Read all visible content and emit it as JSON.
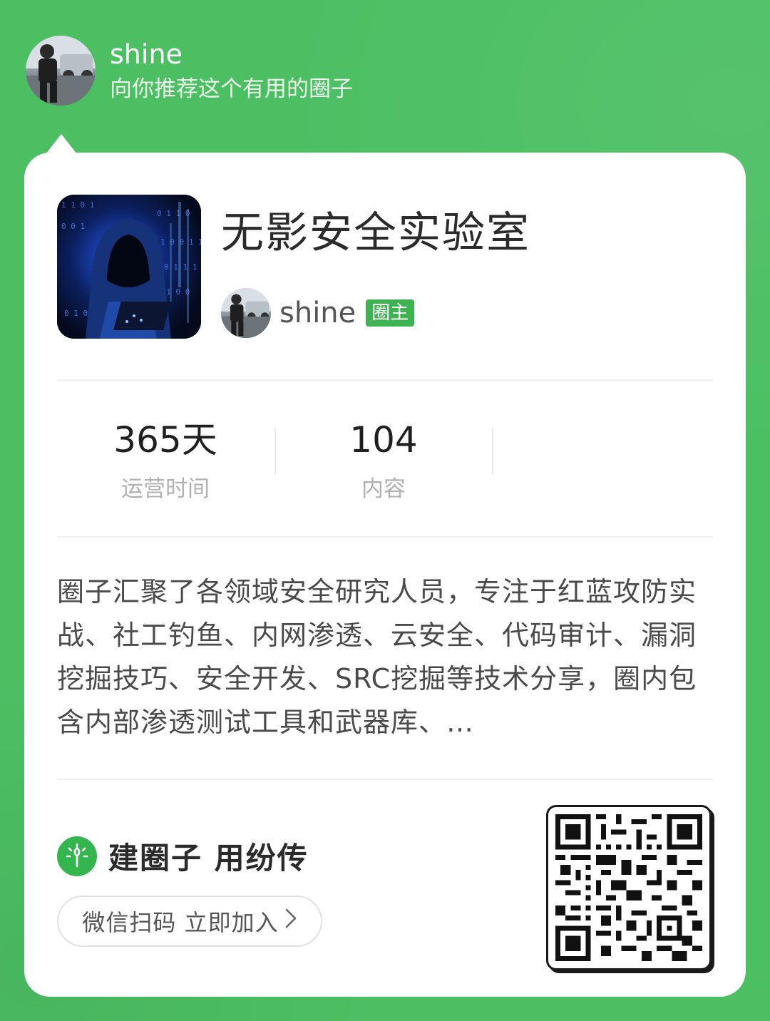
{
  "sharer": {
    "name": "shine",
    "message": "向你推荐这个有用的圈子"
  },
  "group": {
    "title": "无影安全实验室",
    "owner_name": "shine",
    "owner_badge": "圈主"
  },
  "stats": [
    {
      "value": "365天",
      "label": "运营时间"
    },
    {
      "value": "104",
      "label": "内容"
    }
  ],
  "description": "圈子汇聚了各领域安全研究人员，专注于红蓝攻防实战、社工钓鱼、内网渗透、云安全、代码审计、漏洞挖掘技巧、安全开发、SRC挖掘等技术分享，圈内包含内部渗透测试工具和武器库、…",
  "footer": {
    "brand_text": "建圈子 用纷传",
    "join_label": "微信扫码 立即加入",
    "join_icon": "chevron-right-icon"
  },
  "colors": {
    "background": "#4cbf63",
    "accent": "#3fb352",
    "card": "#ffffff"
  }
}
